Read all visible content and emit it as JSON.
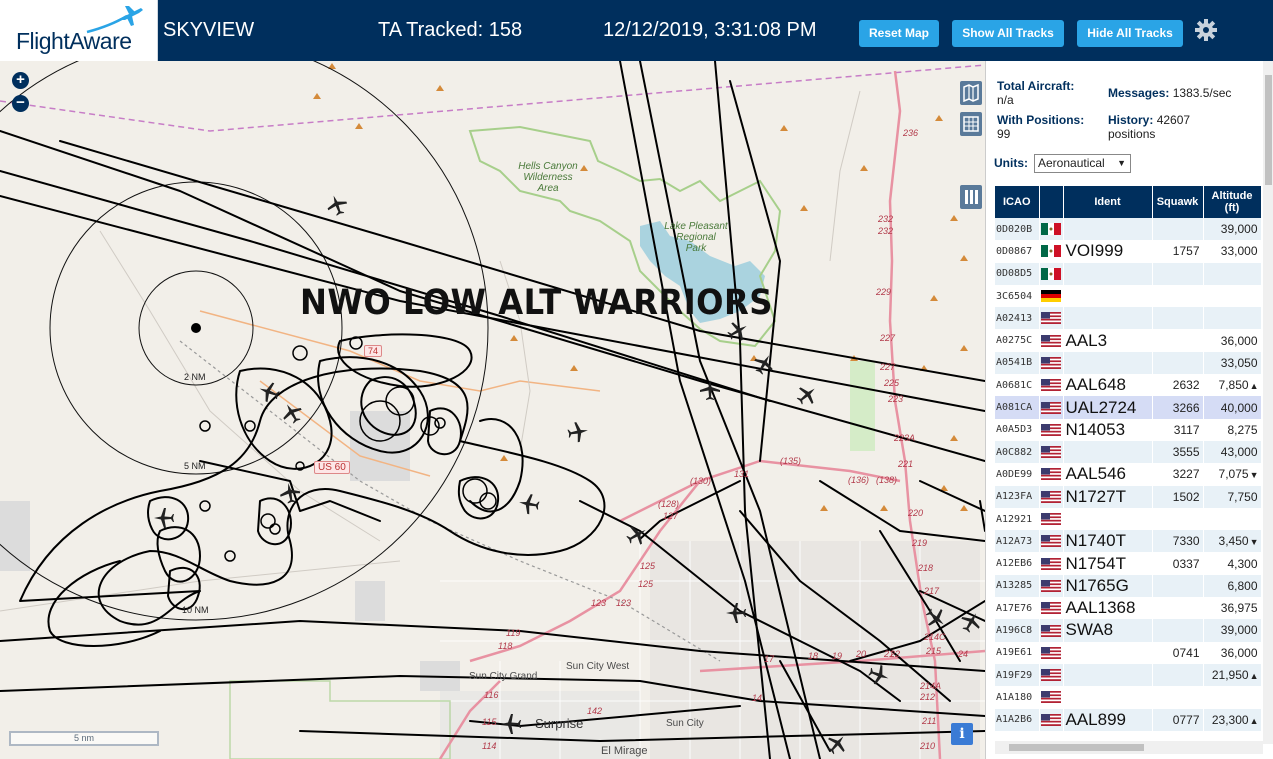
{
  "header": {
    "logo_text": "FlightAware",
    "app_name": "SKYVIEW",
    "tracked": "TA Tracked: 158",
    "clock": "12/12/2019, 3:31:08 PM",
    "buttons": {
      "reset": "Reset Map",
      "show": "Show All Tracks",
      "hide": "Hide All Tracks"
    }
  },
  "map": {
    "overlay_text": "NWO LOW ALT WARRIORS",
    "ring_labels": [
      "2 NM",
      "5 NM",
      "10 NM"
    ],
    "scale": "5 nm",
    "info": "i",
    "places": {
      "sun_city_west": "Sun City West",
      "sun_city_grand": "Sun City Grand",
      "surprise": "Surprise",
      "sun_city": "Sun City",
      "el_mirage": "El Mirage"
    },
    "parks": {
      "hells_canyon": "Hells Canyon\nWilderness\nArea",
      "lake_pleasant": "Lake Pleasant\nRegional\nPark"
    },
    "shields": {
      "us60": "US 60",
      "r74": "74"
    },
    "road_numbers": [
      "236",
      "232",
      "232",
      "229",
      "227",
      "227",
      "225",
      "223",
      "223A",
      "221",
      "220",
      "219",
      "218",
      "217",
      "214C",
      "215",
      "214A",
      "212",
      "211",
      "210",
      "24",
      "22",
      "21",
      "20",
      "19",
      "18",
      "17",
      "14",
      "(135)",
      "(136)",
      "(138)",
      "(130)",
      "131",
      "(128)",
      "127",
      "125",
      "125",
      "123",
      "123",
      "119",
      "118",
      "116",
      "115",
      "114",
      "142"
    ]
  },
  "sidebar": {
    "total_aircraft_label": "Total Aircraft:",
    "total_aircraft_value": "n/a",
    "with_positions_label": "With Positions:",
    "with_positions_value": "99",
    "messages_label": "Messages:",
    "messages_value": "1383.5/sec",
    "history_label": "History:",
    "history_value": "42607",
    "history_unit": "positions",
    "units_label": "Units:",
    "units_value": "Aeronautical",
    "columns": [
      "ICAO",
      "",
      "Ident",
      "Squawk",
      "Altitude (ft)"
    ],
    "rows": [
      {
        "icao": "0D020B",
        "flag": "mx",
        "ident": "",
        "squawk": "",
        "alt": "39,000",
        "trend": "",
        "sel": false
      },
      {
        "icao": "0D0867",
        "flag": "mx",
        "ident": "VOI999",
        "squawk": "1757",
        "alt": "33,000",
        "trend": "",
        "sel": false
      },
      {
        "icao": "0D08D5",
        "flag": "mx",
        "ident": "",
        "squawk": "",
        "alt": "",
        "trend": "",
        "sel": false
      },
      {
        "icao": "3C6504",
        "flag": "de",
        "ident": "",
        "squawk": "",
        "alt": "",
        "trend": "",
        "sel": false
      },
      {
        "icao": "A02413",
        "flag": "us",
        "ident": "",
        "squawk": "",
        "alt": "",
        "trend": "",
        "sel": false
      },
      {
        "icao": "A0275C",
        "flag": "us",
        "ident": "AAL3",
        "squawk": "",
        "alt": "36,000",
        "trend": "",
        "sel": false
      },
      {
        "icao": "A0541B",
        "flag": "us",
        "ident": "",
        "squawk": "",
        "alt": "33,050",
        "trend": "",
        "sel": false
      },
      {
        "icao": "A0681C",
        "flag": "us",
        "ident": "AAL648",
        "squawk": "2632",
        "alt": "7,850",
        "trend": "▲",
        "sel": false
      },
      {
        "icao": "A081CA",
        "flag": "us",
        "ident": "UAL2724",
        "squawk": "3266",
        "alt": "40,000",
        "trend": "",
        "sel": true
      },
      {
        "icao": "A0A5D3",
        "flag": "us",
        "ident": "N14053",
        "squawk": "3117",
        "alt": "8,275",
        "trend": "",
        "sel": false
      },
      {
        "icao": "A0C882",
        "flag": "us",
        "ident": "",
        "squawk": "3555",
        "alt": "43,000",
        "trend": "",
        "sel": false
      },
      {
        "icao": "A0DE99",
        "flag": "us",
        "ident": "AAL546",
        "squawk": "3227",
        "alt": "7,075",
        "trend": "▼",
        "sel": false
      },
      {
        "icao": "A123FA",
        "flag": "us",
        "ident": "N1727T",
        "squawk": "1502",
        "alt": "7,750",
        "trend": "",
        "sel": false
      },
      {
        "icao": "A12921",
        "flag": "us",
        "ident": "",
        "squawk": "",
        "alt": "",
        "trend": "",
        "sel": false
      },
      {
        "icao": "A12A73",
        "flag": "us",
        "ident": "N1740T",
        "squawk": "7330",
        "alt": "3,450",
        "trend": "▼",
        "sel": false
      },
      {
        "icao": "A12EB6",
        "flag": "us",
        "ident": "N1754T",
        "squawk": "0337",
        "alt": "4,300",
        "trend": "",
        "sel": false
      },
      {
        "icao": "A13285",
        "flag": "us",
        "ident": "N1765G",
        "squawk": "",
        "alt": "6,800",
        "trend": "",
        "sel": false
      },
      {
        "icao": "A17E76",
        "flag": "us",
        "ident": "AAL1368",
        "squawk": "",
        "alt": "36,975",
        "trend": "",
        "sel": false
      },
      {
        "icao": "A196C8",
        "flag": "us",
        "ident": "SWA8",
        "squawk": "",
        "alt": "39,000",
        "trend": "",
        "sel": false
      },
      {
        "icao": "A19E61",
        "flag": "us",
        "ident": "",
        "squawk": "0741",
        "alt": "36,000",
        "trend": "",
        "sel": false
      },
      {
        "icao": "A19F29",
        "flag": "us",
        "ident": "",
        "squawk": "",
        "alt": "21,950",
        "trend": "▲",
        "sel": false
      },
      {
        "icao": "A1A180",
        "flag": "us",
        "ident": "",
        "squawk": "",
        "alt": "",
        "trend": "",
        "sel": false
      },
      {
        "icao": "A1A2B6",
        "flag": "us",
        "ident": "AAL899",
        "squawk": "0777",
        "alt": "23,300",
        "trend": "▲",
        "sel": false
      }
    ]
  }
}
